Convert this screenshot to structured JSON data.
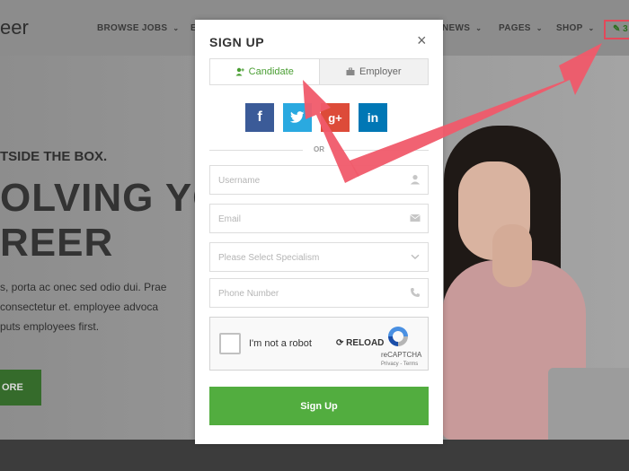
{
  "site": {
    "logo_text": "eer",
    "nav": [
      {
        "label": "BROWSE JOBS",
        "caret": "⌄"
      },
      {
        "label": "E",
        "caret": ""
      },
      {
        "label": "NEWS",
        "caret": "⌄"
      },
      {
        "label": "PAGES",
        "caret": "⌄"
      },
      {
        "label": "SHOP",
        "caret": "⌄"
      }
    ],
    "nav_highlight_text": "✎ 3",
    "hero": {
      "tagline": "TSIDE THE BOX.",
      "headline_1": "OLVING YO",
      "headline_2": "REER",
      "body_lines": [
        "s, porta ac onec sed odio dui. Prae",
        "consectetur et.  employee advoca",
        "puts employees first."
      ],
      "button_label": "ORE"
    }
  },
  "modal": {
    "title": "SIGN UP",
    "close_label": "×",
    "tabs": [
      {
        "label": "Candidate",
        "active": true
      },
      {
        "label": "Employer",
        "active": false
      }
    ],
    "socials": [
      {
        "label": "f",
        "icon": "facebook-icon"
      },
      {
        "label": "t",
        "icon": "twitter-icon"
      },
      {
        "label": "g+",
        "icon": "google-plus-icon"
      },
      {
        "label": "in",
        "icon": "linkedin-icon"
      }
    ],
    "or_text": "OR",
    "fields": {
      "username_placeholder": "Username",
      "email_placeholder": "Email",
      "specialism_placeholder": "Please Select Specialism",
      "phone_placeholder": "Phone Number"
    },
    "captcha": {
      "label": "I'm not a robot",
      "reload_label": "RELOAD",
      "brand": "reCAPTCHA",
      "terms": "Privacy - Terms"
    },
    "submit_label": "Sign Up"
  },
  "colors": {
    "accent_green": "#52ad3f",
    "arrow_red": "#f05a6a",
    "facebook": "#3b5b98",
    "twitter": "#2aa9e0",
    "google": "#dd4b39",
    "linkedin": "#0077b5"
  }
}
